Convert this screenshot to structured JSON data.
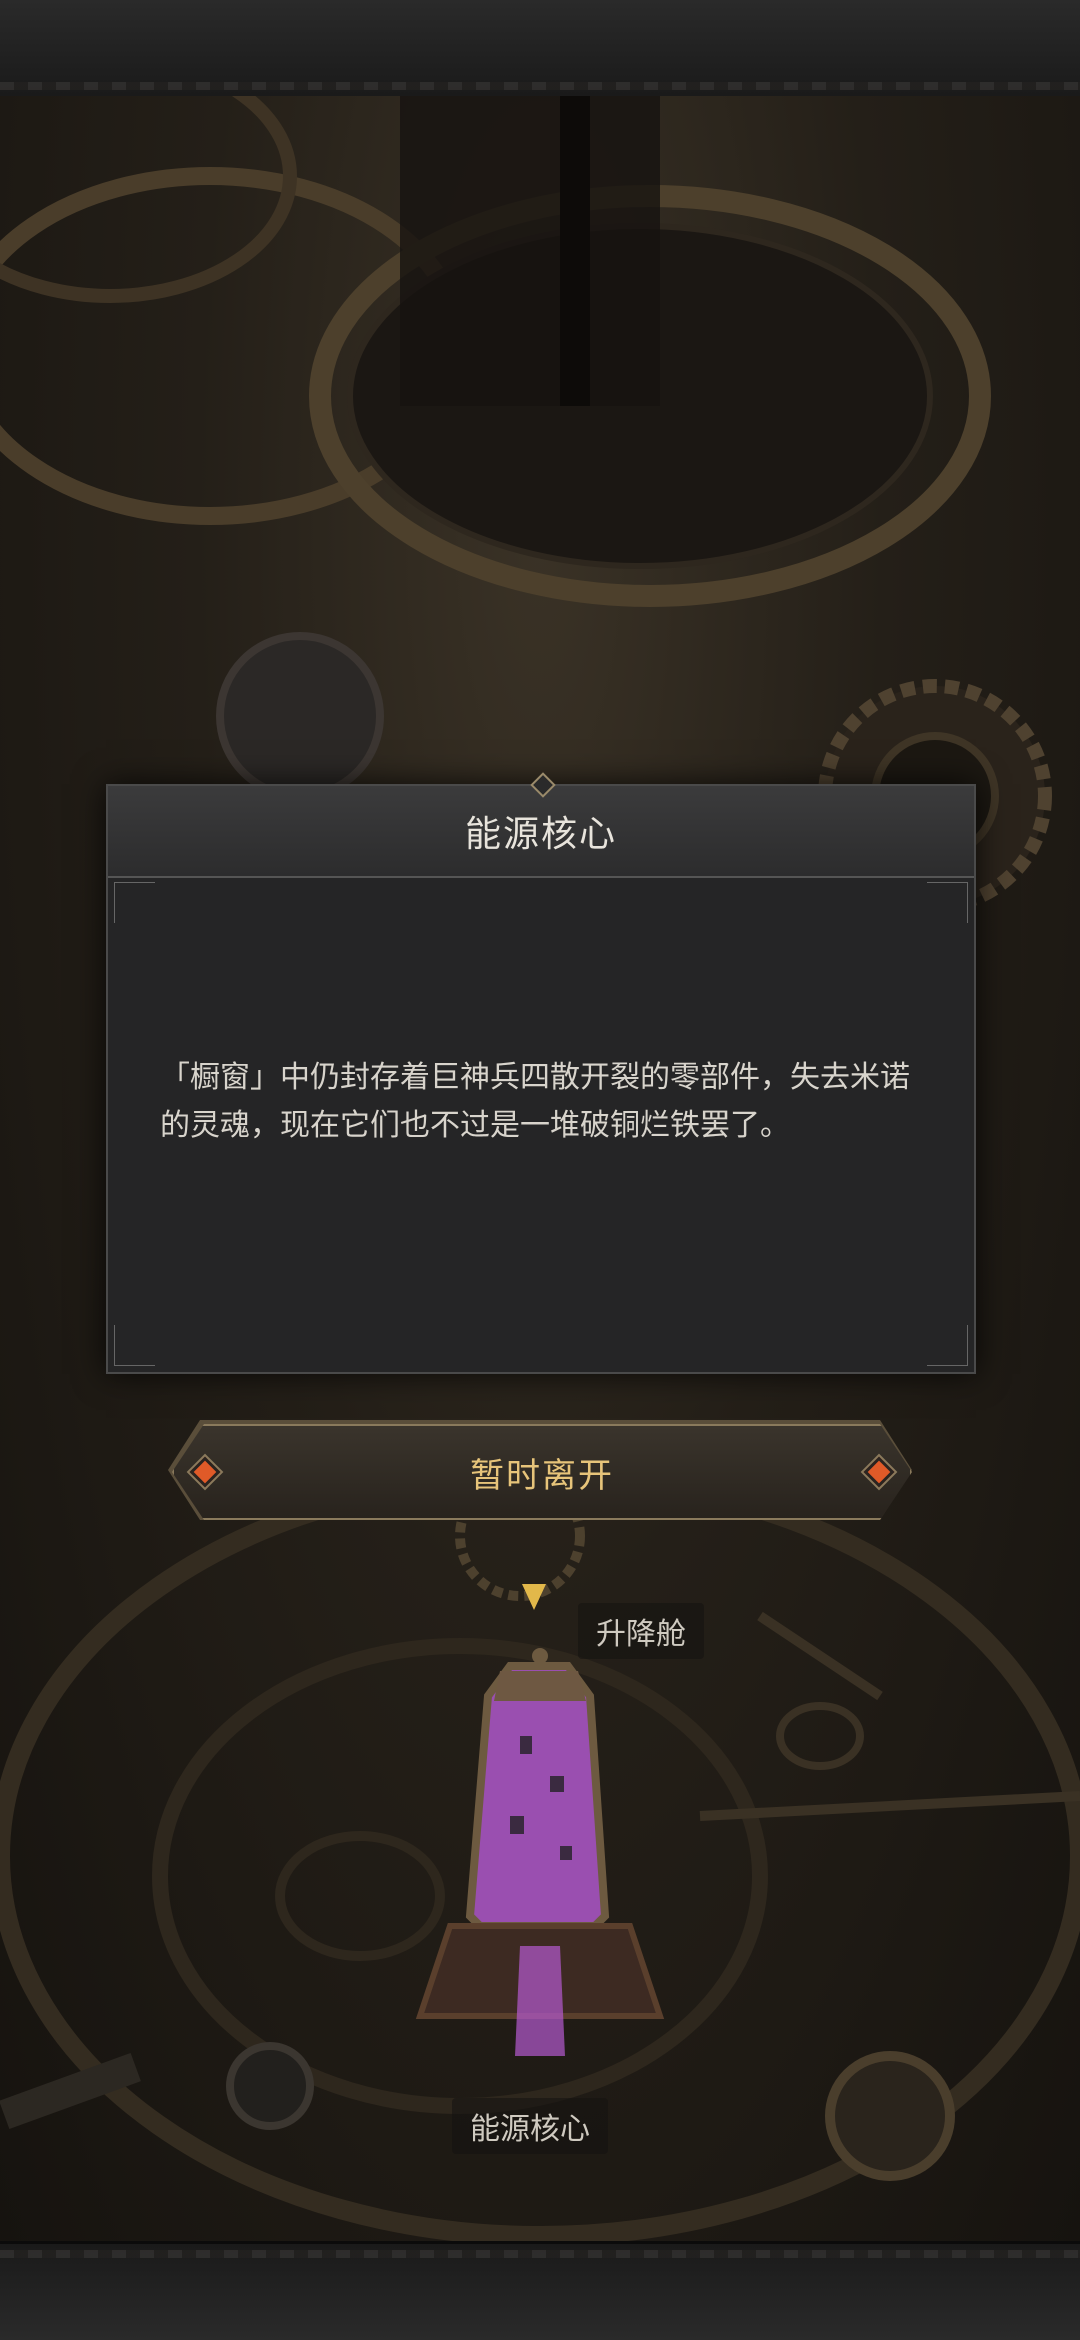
{
  "dialog": {
    "title": "能源核心",
    "body": "「橱窗」中仍封存着巨神兵四散开裂的零部件，失去米诺的灵魂，现在它们也不过是一堆破铜烂铁罢了。"
  },
  "leave_button": {
    "label": "暂时离开"
  },
  "map": {
    "elevator_label": "升降舱",
    "core_label": "能源核心"
  },
  "colors": {
    "accent_gold": "#e7c47a",
    "gem_orange": "#e05a28",
    "crystal_purple": "#9a4fb0",
    "panel_dark": "#252526"
  }
}
